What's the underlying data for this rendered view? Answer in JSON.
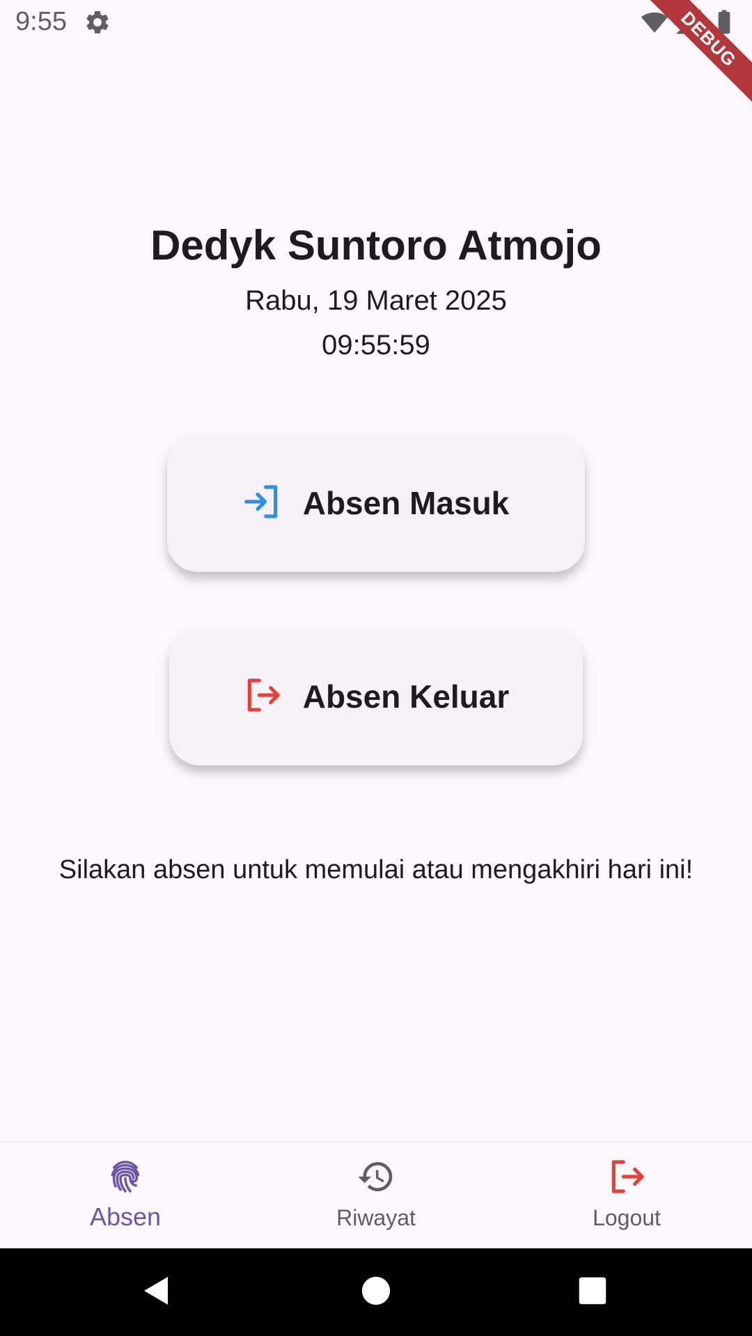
{
  "status_bar": {
    "time": "9:55",
    "settings_icon": "gear-icon",
    "wifi_icon": "wifi-icon",
    "signal_icon": "signal-icon",
    "battery_icon": "battery-icon"
  },
  "debug_banner": "DEBUG",
  "header": {
    "name": "Dedyk Suntoro Atmojo",
    "date": "Rabu, 19 Maret 2025",
    "time": "09:55:59"
  },
  "actions": {
    "check_in": {
      "label": "Absen Masuk",
      "icon": "login-icon",
      "icon_color": "#2f8fe0"
    },
    "check_out": {
      "label": "Absen Keluar",
      "icon": "logout-icon",
      "icon_color": "#e0433b"
    }
  },
  "info_message": "Silakan absen untuk memulai atau mengakhiri hari ini!",
  "bottom_nav": {
    "items": [
      {
        "label": "Absen",
        "icon": "fingerprint-icon",
        "active": true,
        "color": "#6a55a6"
      },
      {
        "label": "Riwayat",
        "icon": "history-icon",
        "active": false,
        "color": "#5f5c64"
      },
      {
        "label": "Logout",
        "icon": "logout-icon",
        "active": false,
        "color": "#e0433b"
      }
    ]
  },
  "system_nav": {
    "back_icon": "back-triangle-icon",
    "home_icon": "home-circle-icon",
    "recent_icon": "recent-square-icon"
  }
}
